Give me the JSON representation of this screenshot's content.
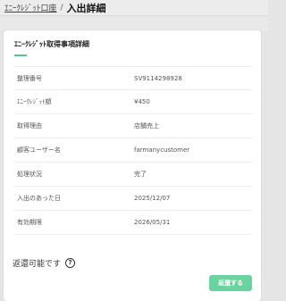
{
  "breadcrumb": {
    "parent": "ｴﾆｰｸﾚｼﾞｯﾄ口座",
    "separator": "/",
    "current": "入出詳細"
  },
  "card": {
    "title": "ｴﾆｰｸﾚｼﾞｯﾄ取得事項詳細",
    "rows": [
      {
        "label": "整理番号",
        "value": "SV9114298928"
      },
      {
        "label": "ｴﾆｰｸﾚｼﾞｯﾄ額",
        "value": "¥450"
      },
      {
        "label": "取得理由",
        "value": "店舗売上"
      },
      {
        "label": "顧客ユーザー名",
        "value": "farmanycustomer"
      },
      {
        "label": "処理状況",
        "value": "完了"
      },
      {
        "label": "入出のあった日",
        "value": "2025/12/07"
      },
      {
        "label": "有効期限",
        "value": "2026/05/31"
      }
    ]
  },
  "refund": {
    "status_text": "返還可能です",
    "help_icon": "question-circle-icon",
    "button_label": "返還する"
  },
  "colors": {
    "accent": "#4fc98c",
    "button": "#6bd3a0",
    "background": "#e5e5e5"
  }
}
